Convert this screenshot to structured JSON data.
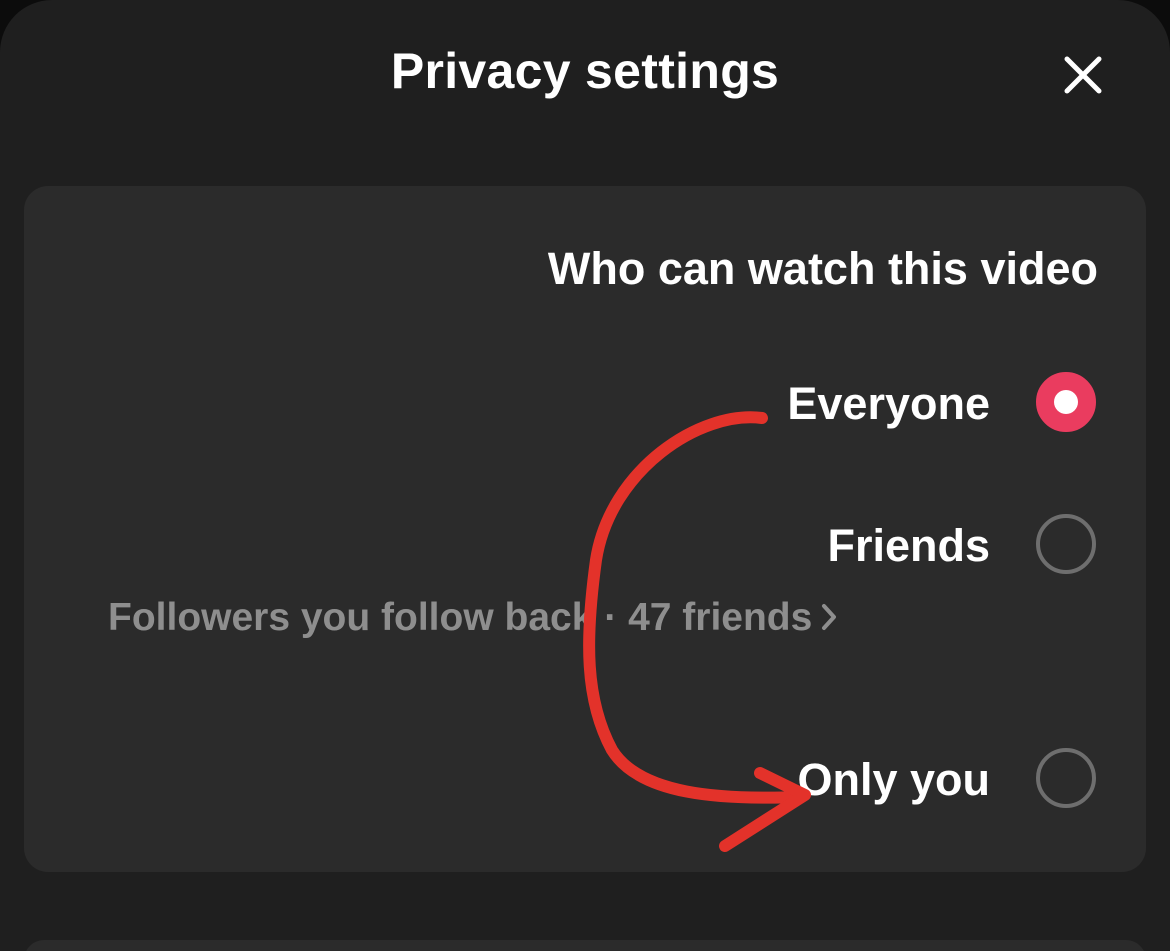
{
  "header": {
    "title": "Privacy settings",
    "close_icon": "close-icon"
  },
  "visibility": {
    "title": "Who can watch this video",
    "options": [
      {
        "label": "Everyone",
        "selected": true
      },
      {
        "label": "Friends",
        "selected": false
      },
      {
        "label": "Only you",
        "selected": false
      }
    ],
    "friends_detail": "Followers you follow back · 47 friends",
    "friends_detail_icon": "chevron-right-icon"
  },
  "colors": {
    "accent": "#ea3c5f",
    "annotation": "#e3322a",
    "background": "#1f1f1f",
    "card": "#2b2b2b",
    "muted_text": "#8e8e8e"
  }
}
